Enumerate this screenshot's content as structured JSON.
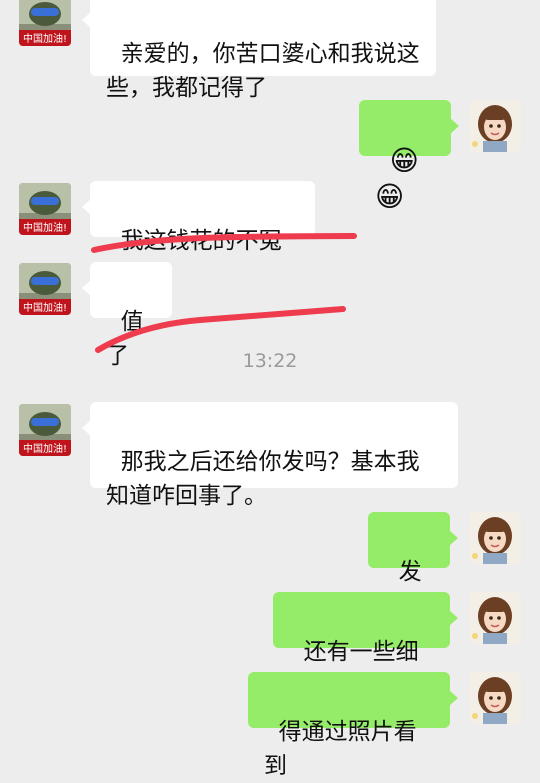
{
  "avatars": {
    "left_badge": "中国加油!"
  },
  "messages": [
    {
      "side": "in",
      "text": "亲爱的，你苦口婆心和我说这些，我都记得了"
    },
    {
      "side": "out",
      "text": "😁😁"
    },
    {
      "side": "in",
      "text": "我这钱花的不冤枉"
    },
    {
      "side": "in",
      "text": "值了"
    },
    {
      "side": "in",
      "text": "那我之后还给你发吗？基本我知道咋回事了。"
    },
    {
      "side": "out",
      "text": "发的"
    },
    {
      "side": "out",
      "text": "还有一些细节"
    },
    {
      "side": "out",
      "text": "得通过照片看到"
    }
  ],
  "timestamp": "13:22",
  "colors": {
    "background": "#ededed",
    "incoming_bubble": "#ffffff",
    "outgoing_bubble": "#95ec69",
    "annotation_red": "#ee3b4e"
  }
}
